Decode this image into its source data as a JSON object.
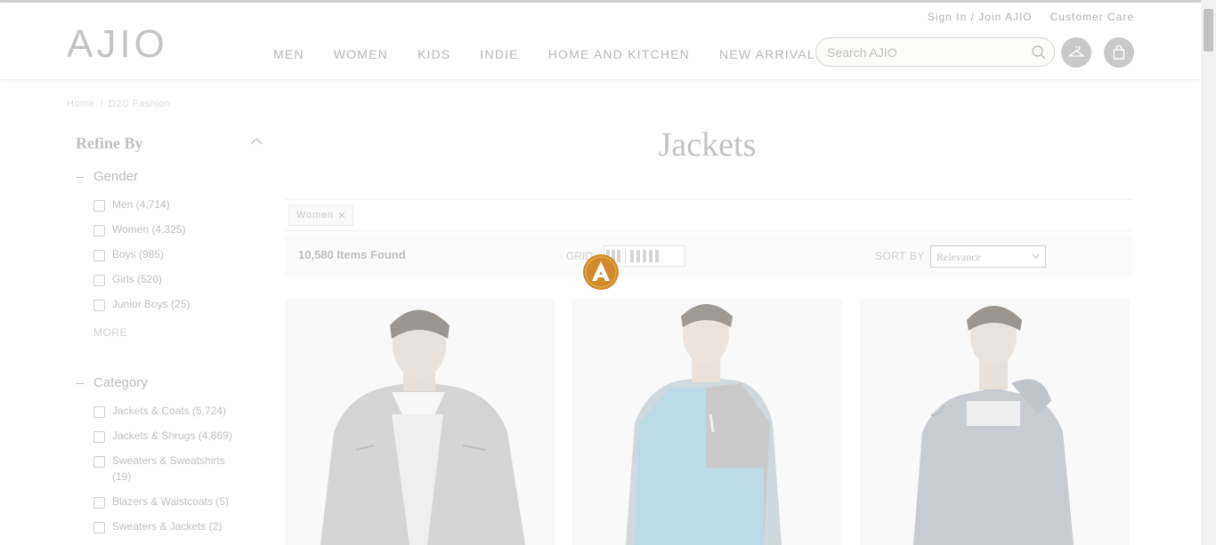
{
  "header": {
    "logo": "AJIO",
    "top_links": [
      "Sign In / Join AJIO",
      "Customer Care"
    ],
    "nav": [
      "MEN",
      "WOMEN",
      "KIDS",
      "INDIE",
      "HOME AND KITCHEN",
      "NEW ARRIVALS"
    ],
    "search_placeholder": "Search AJIO"
  },
  "breadcrumb": [
    "Home",
    "/",
    "D2C Fashion"
  ],
  "sidebar": {
    "refine_title": "Refine By",
    "gender": {
      "title": "Gender",
      "options": [
        "Men (4,714)",
        "Women (4,325)",
        "Boys (985)",
        "Girls (520)",
        "Junior Boys (25)"
      ],
      "more": "MORE"
    },
    "category": {
      "title": "Category",
      "options": [
        "Jackets & Coats (5,724)",
        "Jackets & Shrugs (4,869)",
        "Sweaters & Sweatshirts (19)",
        "Blazers & Waistcoats (5)",
        "Sweaters & Jackets (2)"
      ]
    }
  },
  "main": {
    "title": "Jackets",
    "filter_chip": "Women",
    "items_found": "10,580 Items Found",
    "grid_label": "GRID",
    "sort_label": "SORT BY",
    "sort_value": "Relevance"
  },
  "colors": {
    "loader": "#d18b2a",
    "jacket_blue": "#3f9ac4"
  }
}
